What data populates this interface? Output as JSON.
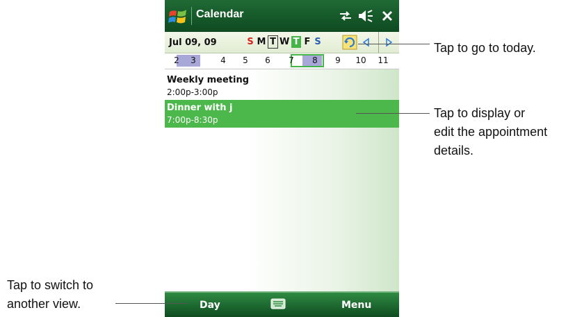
{
  "window": {
    "title": "Calendar"
  },
  "week_header": {
    "date_label": "Jul  09, 09",
    "weekdays": [
      "S",
      "M",
      "T",
      "W",
      "T",
      "F",
      "S"
    ]
  },
  "date_strip": [
    "2",
    "3",
    "4",
    "5",
    "6",
    "7",
    "8",
    "9",
    "10",
    "11"
  ],
  "appointments": [
    {
      "title": "Weekly meeting",
      "time": "2:00p-3:00p"
    },
    {
      "title": "Dinner with j",
      "time": "7:00p-8:30p"
    }
  ],
  "softkeys": {
    "left": "Day",
    "right": "Menu"
  },
  "annotations": {
    "today": "Tap to go to today.",
    "appointment": [
      "Tap to display or",
      "edit the appointment",
      "details."
    ],
    "view": [
      "Tap to switch to",
      "another view."
    ]
  },
  "colors": {
    "titlebar": "#0e4a20",
    "selected_appointment": "#4cb84c",
    "sunday": "#d5231e",
    "saturday": "#2a60b0",
    "selected_day": "#45b54a"
  },
  "icons": [
    "windows-start-icon",
    "connectivity-icon",
    "volume-icon",
    "close-icon",
    "today-icon",
    "previous-arrow-icon",
    "next-arrow-icon",
    "keyboard-icon"
  ]
}
